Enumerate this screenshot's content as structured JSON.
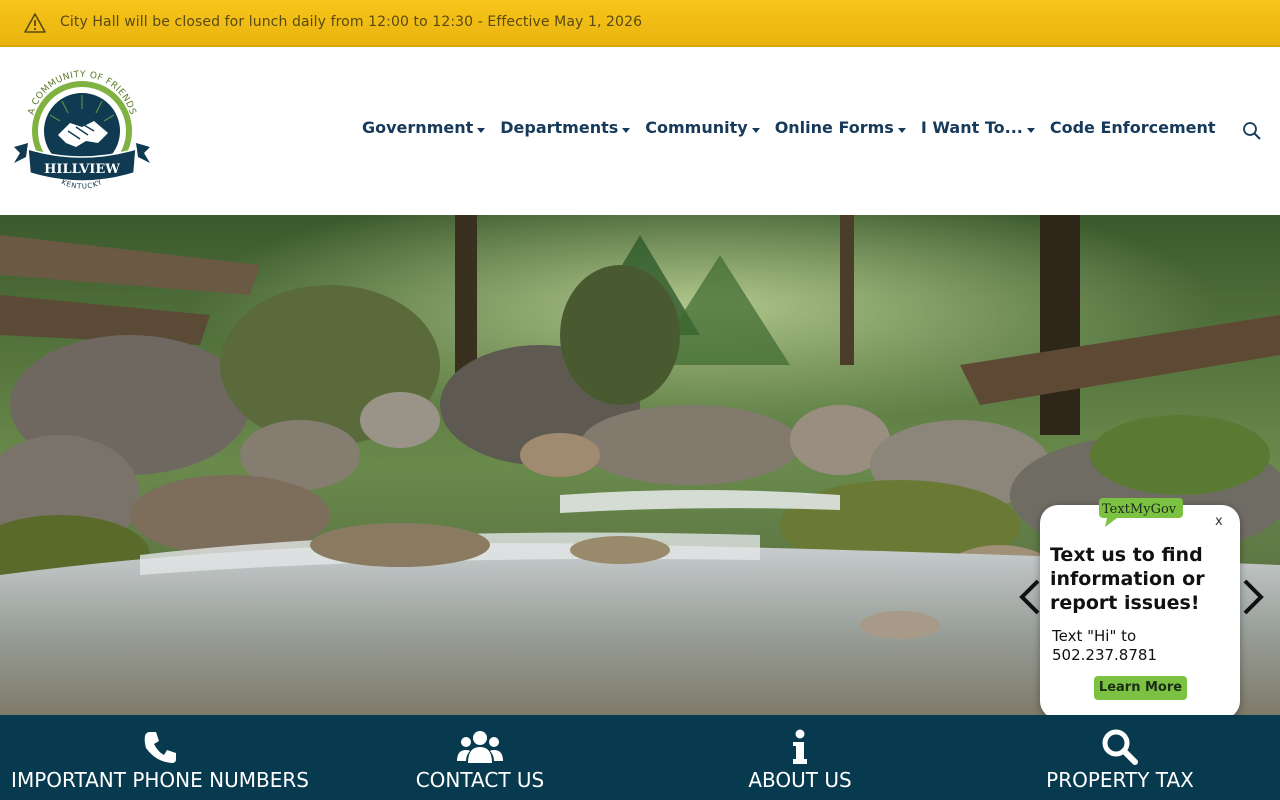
{
  "alert": {
    "icon": "warning-icon",
    "text": "City Hall will be closed for lunch daily from 12:00 to 12:30 - Effective May 1, 2026"
  },
  "logo": {
    "arc_text": "A COMMUNITY OF FRIENDS",
    "name": "HILLVIEW",
    "state": "KENTUCKY",
    "colors": {
      "navy": "#0f3a52",
      "green": "#7fb241"
    }
  },
  "nav": {
    "items": [
      {
        "label": "Government",
        "has_dropdown": true
      },
      {
        "label": "Departments",
        "has_dropdown": true
      },
      {
        "label": "Community",
        "has_dropdown": true
      },
      {
        "label": "Online Forms",
        "has_dropdown": true
      },
      {
        "label": "I Want To...",
        "has_dropdown": true
      },
      {
        "label": "Code Enforcement",
        "has_dropdown": false
      }
    ],
    "search_icon": "search-icon",
    "color": "#17395a"
  },
  "hero": {
    "image": "forest-creek-photo",
    "prev_icon": "chevron-left-icon",
    "next_icon": "chevron-right-icon"
  },
  "textmygov": {
    "badge": "TextMyGov",
    "close": "x",
    "heading": "Text us to find information or report issues!",
    "body": "Text \"Hi\" to 502.237.8781",
    "button": "Learn More",
    "accent": "#7cc242"
  },
  "quick_links": [
    {
      "label": "IMPORTANT PHONE NUMBERS",
      "icon": "phone-icon"
    },
    {
      "label": "CONTACT US",
      "icon": "users-icon"
    },
    {
      "label": "ABOUT US",
      "icon": "info-icon"
    },
    {
      "label": "PROPERTY TAX",
      "icon": "search-icon"
    }
  ],
  "colors": {
    "alert_bg": "#f3c019",
    "quickbar_bg": "#073a4f"
  }
}
